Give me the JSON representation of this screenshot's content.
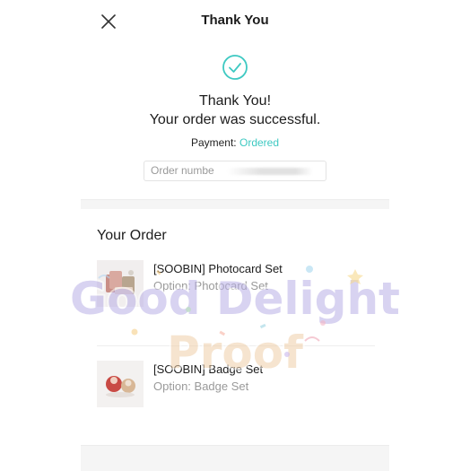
{
  "header": {
    "title": "Thank You",
    "close_icon": "close-icon"
  },
  "success": {
    "icon": "check-circle-icon",
    "line1": "Thank You!",
    "line2": "Your order was successful.",
    "payment_label": "Payment:",
    "payment_status": "Ordered",
    "order_number_label": "Order numbe",
    "accent_color": "#3ec9c2"
  },
  "order": {
    "heading": "Your Order",
    "items": [
      {
        "name": "[SOOBIN] Photocard Set",
        "option": "Option: Photocard Set",
        "thumb": "photocard-thumbnail"
      },
      {
        "name": "[SOOBIN] Badge Set",
        "option": "Option: Badge Set",
        "thumb": "badge-set-thumbnail"
      }
    ]
  },
  "watermark": {
    "line1": "Good Delight",
    "line2": "Proof"
  }
}
